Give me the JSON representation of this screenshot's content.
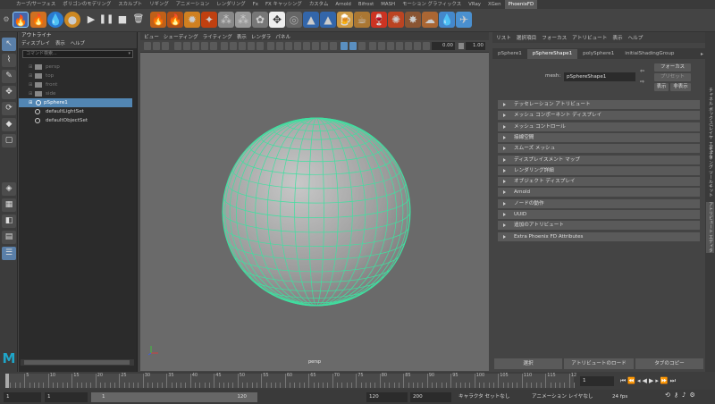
{
  "shelf_tabs": [
    "カーブ/サーフェス",
    "ポリゴンのモデリング",
    "スカルプト",
    "リギング",
    "アニメーション",
    "レンダリング",
    "Fx",
    "FX キャッシング",
    "カスタム",
    "Arnold",
    "Bifrost",
    "MASH",
    "モーション グラフィックス",
    "VRay",
    "XGen",
    "PhoenixFD"
  ],
  "outliner": {
    "title": "アウトライナ",
    "menu": [
      "ディスプレイ",
      "表示",
      "ヘルプ"
    ],
    "search_placeholder": "コマンド検索...",
    "items": [
      {
        "label": "persp",
        "dim": true,
        "kind": "camera"
      },
      {
        "label": "top",
        "dim": true,
        "kind": "camera"
      },
      {
        "label": "front",
        "dim": true,
        "kind": "camera"
      },
      {
        "label": "side",
        "dim": true,
        "kind": "camera"
      },
      {
        "label": "pSphere1",
        "dim": false,
        "kind": "mesh",
        "selected": true
      },
      {
        "label": "defaultLightSet",
        "dim": false,
        "kind": "set"
      },
      {
        "label": "defaultObjectSet",
        "dim": false,
        "kind": "set"
      }
    ]
  },
  "viewport": {
    "menu": [
      "ビュー",
      "シェーディング",
      "ライティング",
      "表示",
      "レンダラ",
      "パネル"
    ],
    "value1": "0.00",
    "value2": "1.00",
    "camera_label": "persp",
    "mesh_color": "#3fe0a0"
  },
  "attribute_editor": {
    "menu": [
      "リスト",
      "選択項目",
      "フォーカス",
      "アトリビュート",
      "表示",
      "ヘルプ"
    ],
    "tabs": [
      "pSphere1",
      "pSphereShape1",
      "polySphere1",
      "initialShadingGroup"
    ],
    "active_tab": 1,
    "mesh_label": "mesh:",
    "mesh_value": "pSphereShape1",
    "focus_button": "フォーカス",
    "preset_button": "プリセット",
    "show_button": "表示",
    "hide_button": "非表示",
    "sections": [
      "テッセレーション アトリビュート",
      "メッシュ コンポーネント ディスプレイ",
      "メッシュ コントロール",
      "接線空間",
      "スムーズ メッシュ",
      "ディスプレイスメント マップ",
      "レンダリング詳細",
      "オブジェクト ディスプレイ",
      "Arnold",
      "ノードの動作",
      "UUID",
      "追加のアトリビュート",
      "Extra Phoenix FD Attributes"
    ],
    "bottom_buttons": [
      "選択",
      "アトリビュートのロード",
      "タブのコピー"
    ],
    "side_tabs": [
      "チャネル ボックス/レイヤ エディタ",
      "モデリング ツールキット",
      "アトリビュート エディタ"
    ]
  },
  "timeline": {
    "ticks": [
      "5",
      "10",
      "15",
      "20",
      "25",
      "30",
      "35",
      "40",
      "45",
      "50",
      "55",
      "60",
      "65",
      "70",
      "75",
      "80",
      "85",
      "90",
      "95",
      "100",
      "105",
      "110",
      "115",
      "12"
    ],
    "current_frame": "1",
    "range_start": "1",
    "range_start2": "1",
    "slider_left": "1",
    "slider_right": "120",
    "range_end": "120",
    "range_end2": "200",
    "character_set": "キャラクタ セットなし",
    "anim_layer": "アニメーション レイヤなし",
    "fps": "24 fps"
  }
}
